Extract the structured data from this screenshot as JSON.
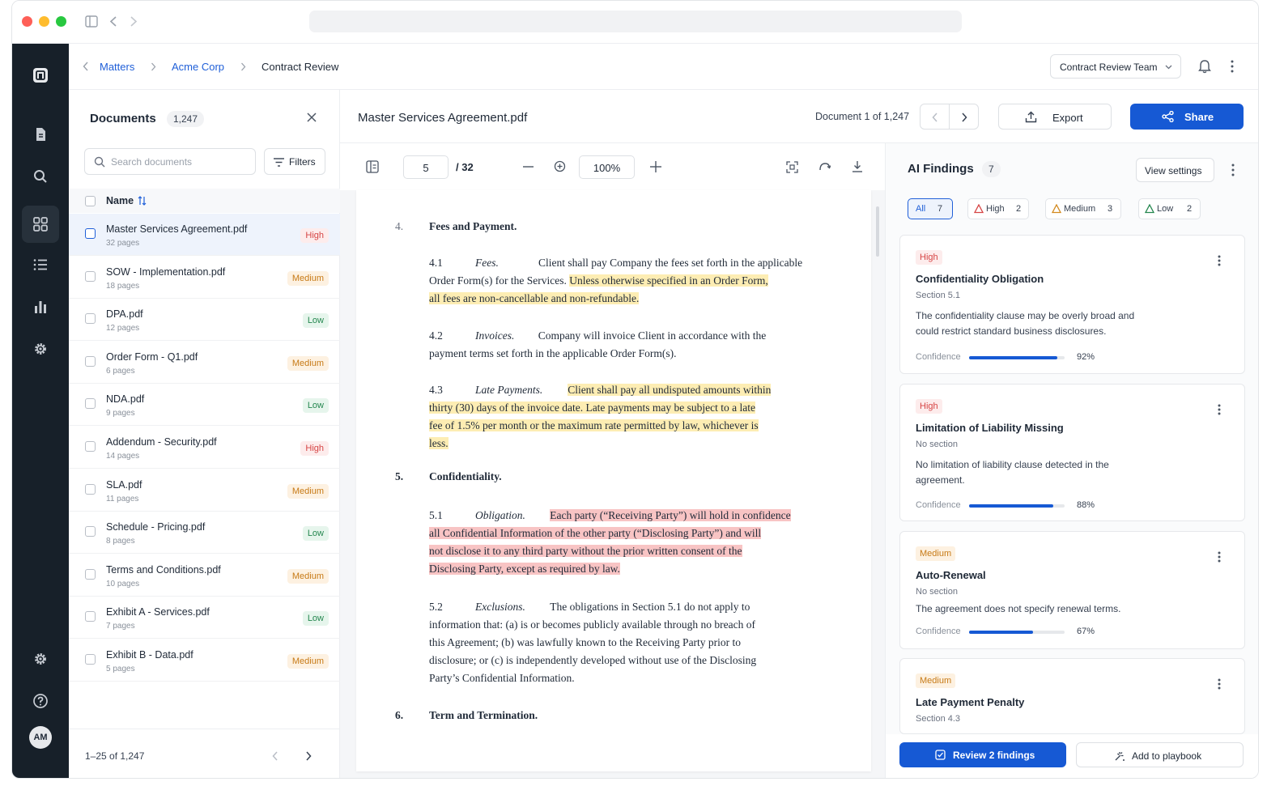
{
  "topbar": {
    "breadcrumb": [
      "Matters",
      "Acme Corp",
      "Contract Review"
    ],
    "team": "Contract Review Team"
  },
  "sidebar": {
    "title": "Documents",
    "count": "1,247",
    "search_placeholder": "Search documents",
    "filters_label": "Filters",
    "column_name": "Name",
    "documents": [
      {
        "name": "Master Services Agreement.pdf",
        "pages": "32 pages",
        "risk": "High"
      },
      {
        "name": "SOW - Implementation.pdf",
        "pages": "18 pages",
        "risk": "Medium"
      },
      {
        "name": "DPA.pdf",
        "pages": "12 pages",
        "risk": "Low"
      },
      {
        "name": "Order Form - Q1.pdf",
        "pages": "6 pages",
        "risk": "Medium"
      },
      {
        "name": "NDA.pdf",
        "pages": "9 pages",
        "risk": "Low"
      },
      {
        "name": "Addendum - Security.pdf",
        "pages": "14 pages",
        "risk": "High"
      },
      {
        "name": "SLA.pdf",
        "pages": "11 pages",
        "risk": "Medium"
      },
      {
        "name": "Schedule - Pricing.pdf",
        "pages": "8 pages",
        "risk": "Low"
      },
      {
        "name": "Terms and Conditions.pdf",
        "pages": "10 pages",
        "risk": "Medium"
      },
      {
        "name": "Exhibit A - Services.pdf",
        "pages": "7 pages",
        "risk": "Low"
      },
      {
        "name": "Exhibit B - Data.pdf",
        "pages": "5 pages",
        "risk": "Medium"
      }
    ],
    "pagination": "1–25 of 1,247"
  },
  "viewer": {
    "filename": "Master Services Agreement.pdf",
    "doc_position": "Document 1 of 1,247",
    "export_label": "Export",
    "share_label": "Share",
    "page_current": "5",
    "page_total": "/ 32",
    "zoom": "100%",
    "lines": [
      {
        "num": "4.",
        "title": "Fees and Payment."
      },
      {
        "segments": [
          {
            "t": "4.1"
          },
          {
            "t": "Fees.",
            "i": true
          },
          {
            "t": "Client shall pay Company the fees set forth in the applicable"
          }
        ]
      },
      {
        "segments": [
          {
            "t": "Order Form(s) for the Services. "
          },
          {
            "t": "Unless otherwise specified in an Order Form,",
            "hl": "y"
          }
        ]
      },
      {
        "segments": [
          {
            "t": "all fees are non-cancellable and non-refundable.",
            "hl": "y"
          }
        ]
      },
      {
        "segments": [
          {
            "t": "4.2"
          },
          {
            "t": "Invoices.",
            "i": true
          },
          {
            "t": "Company will invoice Client in accordance with the"
          }
        ]
      },
      {
        "segments": [
          {
            "t": "payment terms set forth in the applicable Order Form(s)."
          }
        ]
      },
      {
        "segments": [
          {
            "t": "4.3"
          },
          {
            "t": "Late Payments.",
            "i": true
          },
          {
            "t": "Client shall pay all undisputed amounts within",
            "hl": "y"
          }
        ]
      },
      {
        "segments": [
          {
            "t": "thirty (30) days of the invoice date. Late payments may be subject to a late",
            "hl": "y"
          }
        ]
      },
      {
        "segments": [
          {
            "t": "fee of 1.5% per month or the maximum rate permitted by law, whichever is",
            "hl": "y"
          }
        ]
      },
      {
        "segments": [
          {
            "t": "less.",
            "hl": "y"
          }
        ]
      },
      {
        "num": "5.",
        "title": "Confidentiality."
      },
      {
        "segments": [
          {
            "t": "5.1"
          },
          {
            "t": "Obligation.",
            "i": true
          },
          {
            "t": "Each party (“Receiving Party”) will hold in confidence",
            "hl": "r"
          }
        ]
      },
      {
        "segments": [
          {
            "t": "all Confidential Information of the other party (“Disclosing Party”) and will",
            "hl": "r"
          }
        ]
      },
      {
        "segments": [
          {
            "t": "not disclose it to any third party without the prior written consent of the",
            "hl": "r"
          }
        ]
      },
      {
        "segments": [
          {
            "t": "Disclosing Party, except as required by law.",
            "hl": "r"
          }
        ]
      },
      {
        "segments": [
          {
            "t": "5.2"
          },
          {
            "t": "Exclusions.",
            "i": true
          },
          {
            "t": "The obligations in Section 5.1 do not apply to"
          }
        ]
      },
      {
        "segments": [
          {
            "t": "information that: (a) is or becomes publicly available through no breach of"
          }
        ]
      },
      {
        "segments": [
          {
            "t": "this Agreement; (b) was lawfully known to the Receiving Party prior to"
          }
        ]
      },
      {
        "segments": [
          {
            "t": "disclosure; or (c) is independently developed without use of the Disclosing"
          }
        ]
      },
      {
        "segments": [
          {
            "t": "Party’s Confidential Information."
          }
        ]
      },
      {
        "num": "6.",
        "title": "Term and Termination."
      }
    ]
  },
  "findings": {
    "title": "AI Findings",
    "count": "7",
    "view_settings_label": "View settings",
    "filters": [
      {
        "label": "All",
        "count": "7"
      },
      {
        "label": "High",
        "count": "2"
      },
      {
        "label": "Medium",
        "count": "3"
      },
      {
        "label": "Low",
        "count": "2"
      }
    ],
    "cards": [
      {
        "severity": "High",
        "title": "Confidentiality Obligation",
        "section": "Section 5.1",
        "desc": "The confidentiality clause may be overly broad and could restrict standard business disclosures.",
        "confidence_label": "Confidence",
        "confidence": 92,
        "confidence_text": "92%"
      },
      {
        "severity": "High",
        "title": "Limitation of Liability Missing",
        "section": "No section",
        "desc": "No limitation of liability clause detected in the agreement.",
        "confidence_label": "Confidence",
        "confidence": 88,
        "confidence_text": "88%"
      },
      {
        "severity": "Medium",
        "title": "Auto-Renewal",
        "section": "No section",
        "desc": "The agreement does not specify renewal terms.",
        "confidence_label": "Confidence",
        "confidence": 67,
        "confidence_text": "67%"
      },
      {
        "severity": "Medium",
        "title": "Late Payment Penalty",
        "section": "Section 4.3"
      }
    ],
    "review_label": "Review 2 findings",
    "playbook_label": "Add to playbook"
  },
  "user": {
    "initials": "AM"
  }
}
